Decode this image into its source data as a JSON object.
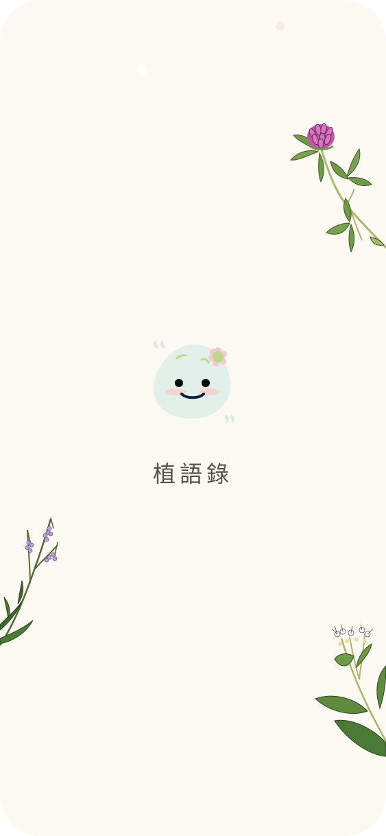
{
  "app": {
    "title": "植語錄"
  },
  "colors": {
    "background": "#fcf9f3",
    "mascot_body": "#e3efe9",
    "mascot_blush": "#f6d3d3",
    "mascot_mouth": "#0f2040",
    "quote_mark": "#d7e9e2",
    "flower_petal": "#f2c9cf",
    "flower_center": "#bcd98a",
    "title_text": "#55524e"
  },
  "icons": {
    "mascot": "smiling-plant-blob-mascot",
    "open_quote": "open-quote-icon",
    "close_quote": "close-quote-icon",
    "clover": "red-clover-illustration",
    "lavender": "vervain-illustration",
    "white_flower": "white-flower-illustration"
  }
}
